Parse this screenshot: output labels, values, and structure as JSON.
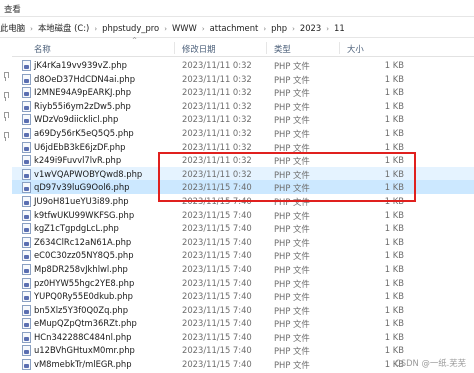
{
  "menubar": {
    "view_label": "查看"
  },
  "breadcrumb": [
    "此电脑",
    "本地磁盘 (C:)",
    "phpstudy_pro",
    "WWW",
    "attachment",
    "php",
    "2023",
    "11"
  ],
  "columns": {
    "name": "名称",
    "date": "修改日期",
    "type": "类型",
    "size": "大小"
  },
  "files": [
    {
      "name": "jK4rKa19vv939vZ.php",
      "date": "2023/11/11 0:32",
      "type": "PHP 文件",
      "size": "1 KB"
    },
    {
      "name": "d8OeD37HdCDN4ai.php",
      "date": "2023/11/11 0:32",
      "type": "PHP 文件",
      "size": "1 KB"
    },
    {
      "name": "I2MNE94A9pEARKJ.php",
      "date": "2023/11/11 0:32",
      "type": "PHP 文件",
      "size": "1 KB"
    },
    {
      "name": "Riyb55i6ym2zDw5.php",
      "date": "2023/11/11 0:32",
      "type": "PHP 文件",
      "size": "1 KB"
    },
    {
      "name": "WDzVo9diicklicl.php",
      "date": "2023/11/11 0:32",
      "type": "PHP 文件",
      "size": "1 KB"
    },
    {
      "name": "a69Dy56rK5eQ5Q5.php",
      "date": "2023/11/11 0:32",
      "type": "PHP 文件",
      "size": "1 KB"
    },
    {
      "name": "U6jdEbB3kE6jzDF.php",
      "date": "2023/11/11 0:32",
      "type": "PHP 文件",
      "size": "1 KB"
    },
    {
      "name": "k249i9Fuvvl7lvR.php",
      "date": "2023/11/11 0:32",
      "type": "PHP 文件",
      "size": "1 KB"
    },
    {
      "name": "v1wVQAPWOBYQwd8.php",
      "date": "2023/11/11 0:32",
      "type": "PHP 文件",
      "size": "1 KB"
    },
    {
      "name": "qD97v39luG9Ool6.php",
      "date": "2023/11/15 7:40",
      "type": "PHP 文件",
      "size": "1 KB"
    },
    {
      "name": "JU9oH81ueYU3i89.php",
      "date": "2023/11/15 7:40",
      "type": "PHP 文件",
      "size": "1 KB"
    },
    {
      "name": "k9tfwUKU99WKFSG.php",
      "date": "2023/11/15 7:40",
      "type": "PHP 文件",
      "size": "1 KB"
    },
    {
      "name": "kgZ1cTgpdgLcL.php",
      "date": "2023/11/15 7:40",
      "type": "PHP 文件",
      "size": "1 KB"
    },
    {
      "name": "Z634ClRc12aN61A.php",
      "date": "2023/11/15 7:40",
      "type": "PHP 文件",
      "size": "1 KB"
    },
    {
      "name": "eC0C30zz05NY8Q5.php",
      "date": "2023/11/15 7:40",
      "type": "PHP 文件",
      "size": "1 KB"
    },
    {
      "name": "Mp8DR258vJkhlwl.php",
      "date": "2023/11/15 7:40",
      "type": "PHP 文件",
      "size": "1 KB"
    },
    {
      "name": "pz0HYW55hgc2YE8.php",
      "date": "2023/11/15 7:40",
      "type": "PHP 文件",
      "size": "1 KB"
    },
    {
      "name": "YUPQ0Ry55E0dkub.php",
      "date": "2023/11/15 7:40",
      "type": "PHP 文件",
      "size": "1 KB"
    },
    {
      "name": "bn5Xlz5Y3f0Q0Zq.php",
      "date": "2023/11/15 7:40",
      "type": "PHP 文件",
      "size": "1 KB"
    },
    {
      "name": "eMupQZpQtm36RZt.php",
      "date": "2023/11/15 7:40",
      "type": "PHP 文件",
      "size": "1 KB"
    },
    {
      "name": "HCn342288C484nl.php",
      "date": "2023/11/15 7:40",
      "type": "PHP 文件",
      "size": "1 KB"
    },
    {
      "name": "u12BVhGHtuxM0mr.php",
      "date": "2023/11/15 7:40",
      "type": "PHP 文件",
      "size": "1 KB"
    },
    {
      "name": "vM8mebkTr/mlEGR.php",
      "date": "2023/11/15 7:40",
      "type": "PHP 文件",
      "size": "1 KB"
    }
  ],
  "watermark": "CSDN @一纸.芜芜",
  "colors": {
    "selected_row": "#cce8ff",
    "hover_row": "#e5f3ff",
    "highlight_box": "#e0201e",
    "header_text": "#4c607a"
  }
}
